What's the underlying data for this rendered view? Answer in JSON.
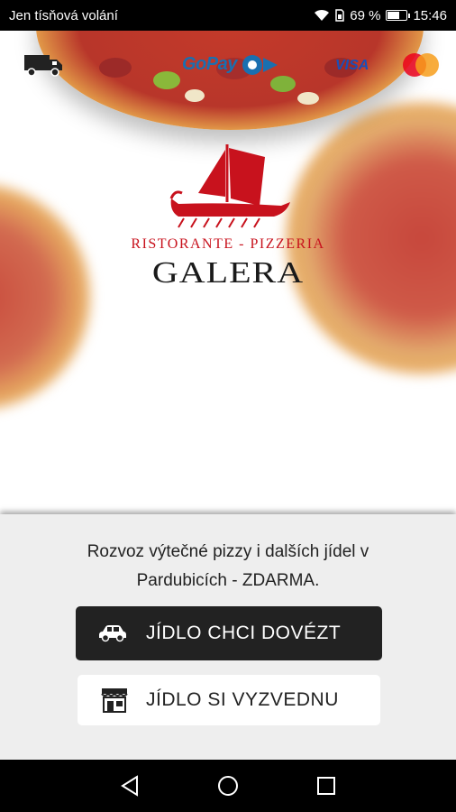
{
  "status_bar": {
    "carrier": "Jen tísňová volání",
    "battery_percent": "69 %",
    "battery_level": 0.69,
    "time": "15:46"
  },
  "payment_logos": {
    "gopay": "GoPay",
    "visa": "VISA"
  },
  "brand": {
    "tagline": "RISTORANTE - PIZZERIA",
    "name": "GALERA"
  },
  "sheet": {
    "description_line1": "Rozvoz výtečné pizzy i dalších jídel v",
    "description_line2": "Pardubicích - ZDARMA.",
    "delivery_button": "JÍDLO CHCI DOVÉZT",
    "pickup_button": "JÍDLO SI VYZVEDNU"
  },
  "icons": {
    "delivery": "car-icon",
    "pickup": "shop-icon",
    "truck": "truck-icon"
  },
  "colors": {
    "brand_red": "#c8121d",
    "primary_button": "#222222",
    "sheet_bg": "#eeeeee"
  }
}
